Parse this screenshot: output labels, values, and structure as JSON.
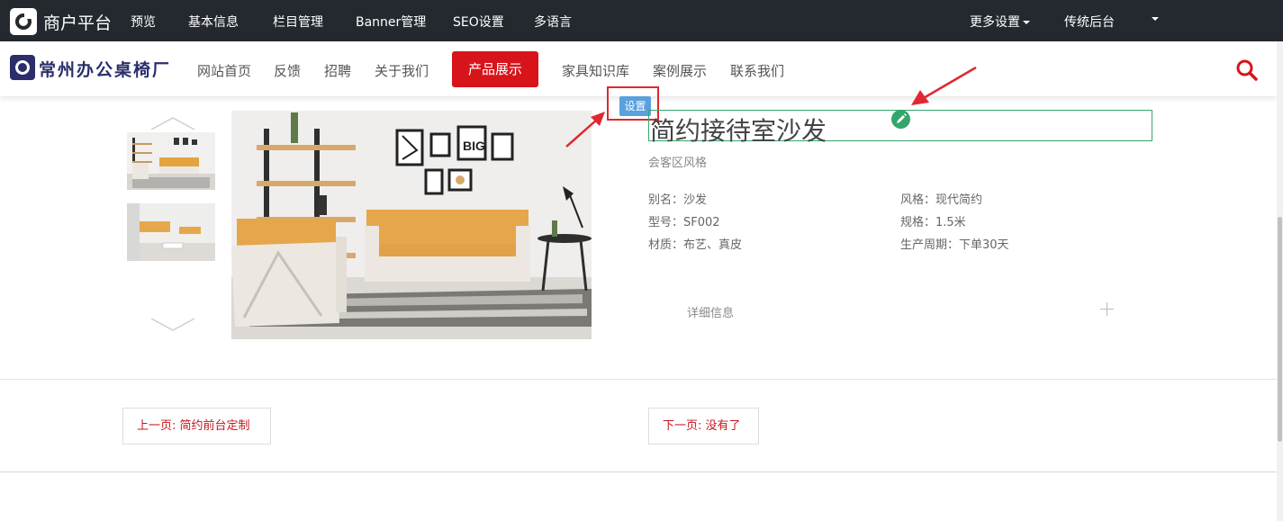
{
  "admin_bar": {
    "title": "商户平台",
    "menu": [
      {
        "label": "预览"
      },
      {
        "label": "基本信息"
      },
      {
        "label": "栏目管理"
      },
      {
        "label": "Banner管理"
      },
      {
        "label": "SEO设置"
      },
      {
        "label": "多语言"
      }
    ],
    "more_settings": "更多设置",
    "legacy_backend": "传统后台"
  },
  "site": {
    "name": "常州办公桌椅厂",
    "nav": [
      {
        "label": "网站首页"
      },
      {
        "label": "反馈"
      },
      {
        "label": "招聘"
      },
      {
        "label": "关于我们"
      },
      {
        "label": "产品展示",
        "active": true
      },
      {
        "label": "家具知识库"
      },
      {
        "label": "案例展示"
      },
      {
        "label": "联系我们"
      }
    ],
    "brand_color": "#d7141a"
  },
  "product": {
    "settings_label": "设置",
    "title": "简约接待室沙发",
    "subtitle": "会客区风格",
    "specs": [
      {
        "text": "别名：沙发"
      },
      {
        "text": "风格：现代简约"
      },
      {
        "text": "型号：SF002"
      },
      {
        "text": "规格：1.5米"
      },
      {
        "text": "材质：布艺、真皮"
      },
      {
        "text": "生产周期：下单30天"
      }
    ],
    "detail_label": "详细信息",
    "thumbnail_count": 2
  },
  "pager": {
    "prev": "上一页: 简约前台定制",
    "next": "下一页: 没有了"
  },
  "icons": {
    "search": "search-icon",
    "edit": "pencil-icon",
    "expand": "plus-icon",
    "up": "chevron-up-icon",
    "down": "chevron-down-icon"
  }
}
